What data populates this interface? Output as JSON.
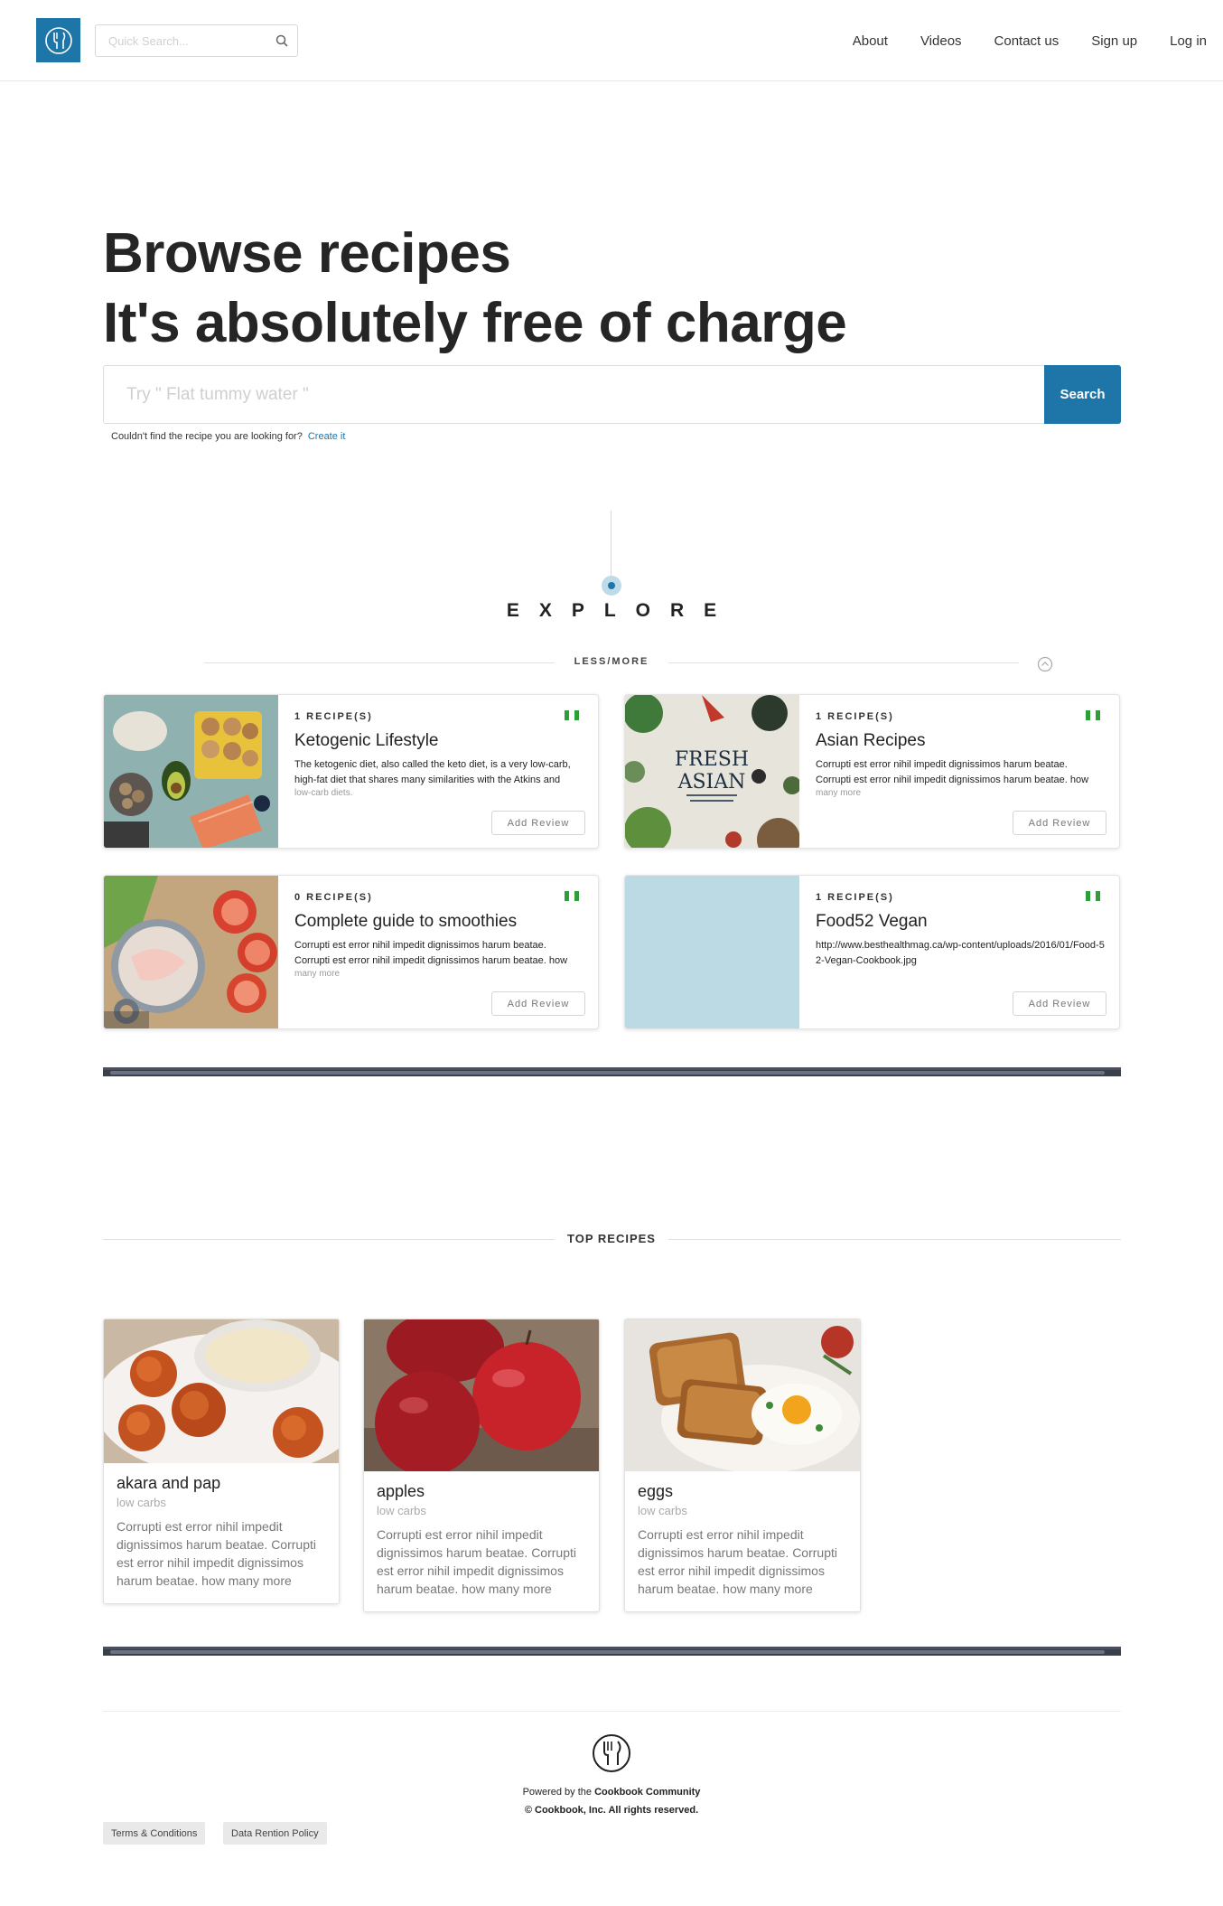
{
  "header": {
    "quick_search_placeholder": "Quick Search...",
    "nav": [
      "About",
      "Videos",
      "Contact us",
      "Sign up",
      "Log in"
    ]
  },
  "hero": {
    "line1": "Browse recipes",
    "line2": "It's absolutely free of charge",
    "search_placeholder": "Try \" Flat tummy water \"",
    "search_button": "Search",
    "hint": "Couldn't find the recipe you are looking for?",
    "hint_link": "Create it"
  },
  "explore": {
    "title": "EXPLORE",
    "toggle_label": "LESS/MORE",
    "cards": [
      {
        "count": "1 RECIPE(S)",
        "title": "Ketogenic Lifestyle",
        "desc": "The ketogenic diet, also called the keto diet, is a very low-carb, high-fat diet that shares many similarities with the Atkins and",
        "more": "low-carb diets.",
        "review": "Add Review"
      },
      {
        "count": "1 RECIPE(S)",
        "title": "Asian Recipes",
        "desc": "Corrupti est error nihil impedit dignissimos harum beatae. Corrupti est error nihil impedit dignissimos harum beatae. how",
        "more": "many more",
        "review": "Add Review"
      },
      {
        "count": "0 RECIPE(S)",
        "title": "Complete guide to smoothies",
        "desc": "Corrupti est error nihil impedit dignissimos harum beatae. Corrupti est error nihil impedit dignissimos harum beatae. how",
        "more": "many more",
        "review": "Add Review"
      },
      {
        "count": "1 RECIPE(S)",
        "title": "Food52 Vegan",
        "desc": "http://www.besthealthmag.ca/wp-content/uploads/2016/01/Food-52-Vegan-Cookbook.jpg",
        "more": "",
        "review": "Add Review"
      }
    ]
  },
  "top_recipes": {
    "title": "TOP RECIPES",
    "items": [
      {
        "name": "akara and pap",
        "tag": "low carbs",
        "desc": "Corrupti est error nihil impedit dignissimos harum beatae. Corrupti est error nihil impedit dignissimos harum beatae. how many more"
      },
      {
        "name": "apples",
        "tag": "low carbs",
        "desc": "Corrupti est error nihil impedit dignissimos harum beatae. Corrupti est error nihil impedit dignissimos harum beatae. how many more"
      },
      {
        "name": "eggs",
        "tag": "low carbs",
        "desc": "Corrupti est error nihil impedit dignissimos harum beatae. Corrupti est error nihil impedit dignissimos harum beatae. how many more"
      }
    ]
  },
  "footer": {
    "powered_prefix": "Powered by the",
    "powered_name": "Cookbook Community",
    "copyright": "© Cookbook, Inc. All rights reserved.",
    "links": [
      "Terms & Conditions",
      "Data Rention Policy"
    ]
  },
  "colors": {
    "brand": "#1d75a8",
    "flag_green": "#2e9d3a"
  }
}
